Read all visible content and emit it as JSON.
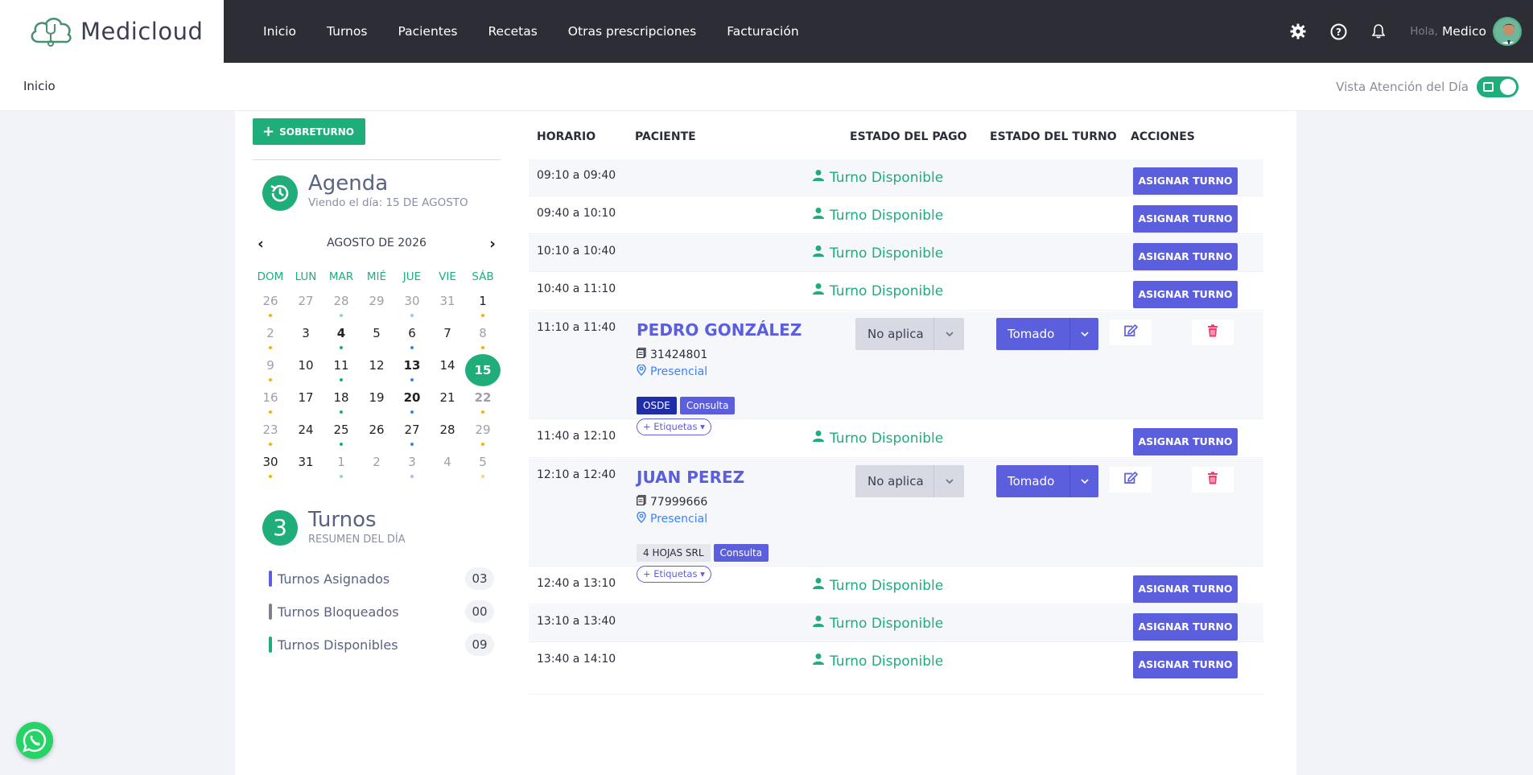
{
  "app": {
    "name": "Medicloud"
  },
  "nav": {
    "items": [
      "Inicio",
      "Turnos",
      "Pacientes",
      "Recetas",
      "Otras prescripciones",
      "Facturación"
    ]
  },
  "user": {
    "greeting": "Hola,",
    "name": "Medico"
  },
  "subbar": {
    "breadcrumb": "Inicio",
    "vista_label": "Vista Atención del Día",
    "vista_on": true
  },
  "sobreturno_label": "SOBRETURNO",
  "agenda": {
    "title": "Agenda",
    "subtitle": "Viendo el día: 15 DE AGOSTO"
  },
  "calendar": {
    "month": "AGOSTO DE 2026",
    "prev": "‹",
    "next": "›",
    "dow": [
      "DOM",
      "LUN",
      "MAR",
      "MIÉ",
      "JUE",
      "VIE",
      "SÁB"
    ],
    "weeks": [
      [
        "26",
        "27",
        "28",
        "29",
        "30",
        "31",
        "1"
      ],
      [
        "2",
        "3",
        "4",
        "5",
        "6",
        "7",
        "8"
      ],
      [
        "9",
        "10",
        "11",
        "12",
        "13",
        "14",
        "15"
      ],
      [
        "16",
        "17",
        "18",
        "19",
        "20",
        "21",
        "22"
      ],
      [
        "23",
        "24",
        "25",
        "26",
        "27",
        "28",
        "29"
      ],
      [
        "30",
        "31",
        "1",
        "2",
        "3",
        "4",
        "5"
      ]
    ],
    "selected": "15"
  },
  "turnos_summary": {
    "count_icon": "3",
    "title": "Turnos",
    "subtitle": "RESUMEN DEL DÍA",
    "stats": [
      {
        "label": "Turnos Asignados",
        "count": "03",
        "color": "#5b5fde"
      },
      {
        "label": "Turnos Bloqueados",
        "count": "00",
        "color": "#7d7f8c"
      },
      {
        "label": "Turnos Disponibles",
        "count": "09",
        "color": "#1fad7a"
      }
    ]
  },
  "table": {
    "headers": [
      "HORARIO",
      "PACIENTE",
      "ESTADO DEL PAGO",
      "ESTADO DEL TURNO",
      "ACCIONES"
    ],
    "disponible_label": "Turno Disponible",
    "asignar_label": "ASIGNAR TURNO",
    "rows": [
      {
        "time": "09:10 a 09:40",
        "type": "free"
      },
      {
        "time": "09:40 a 10:10",
        "type": "free"
      },
      {
        "time": "10:10 a 10:40",
        "type": "free"
      },
      {
        "time": "10:40 a 11:10",
        "type": "free"
      },
      {
        "time": "11:10 a 11:40",
        "type": "booked",
        "patient": "PEDRO GONZÁLEZ",
        "dni": "31424801",
        "modality": "Presencial",
        "tags": [
          {
            "text": "OSDE",
            "bg": "#1f2da8",
            "fg": "#ffffff"
          },
          {
            "text": "Consulta",
            "bg": "#5b5fde",
            "fg": "#ffffff"
          }
        ],
        "etiquetas": "+ Etiquetas ▾",
        "pago": "No aplica",
        "estado": "Tomado"
      },
      {
        "time": "11:40 a 12:10",
        "type": "free"
      },
      {
        "time": "12:10 a 12:40",
        "type": "booked",
        "patient": "JUAN PEREZ",
        "dni": "77999666",
        "modality": "Presencial",
        "tags": [
          {
            "text": "4 HOJAS SRL",
            "bg": "#e6e7ec",
            "fg": "#2b2e3a"
          },
          {
            "text": "Consulta",
            "bg": "#5b5fde",
            "fg": "#ffffff"
          }
        ],
        "etiquetas": "+ Etiquetas ▾",
        "pago": "No aplica",
        "estado": "Tomado"
      },
      {
        "time": "12:40 a 13:10",
        "type": "free"
      },
      {
        "time": "13:10 a 13:40",
        "type": "free"
      },
      {
        "time": "13:40 a 14:10",
        "type": "free"
      }
    ]
  },
  "colors": {
    "accent": "#5b5fde",
    "green": "#1fad7a",
    "dark": "#2d2d36"
  }
}
